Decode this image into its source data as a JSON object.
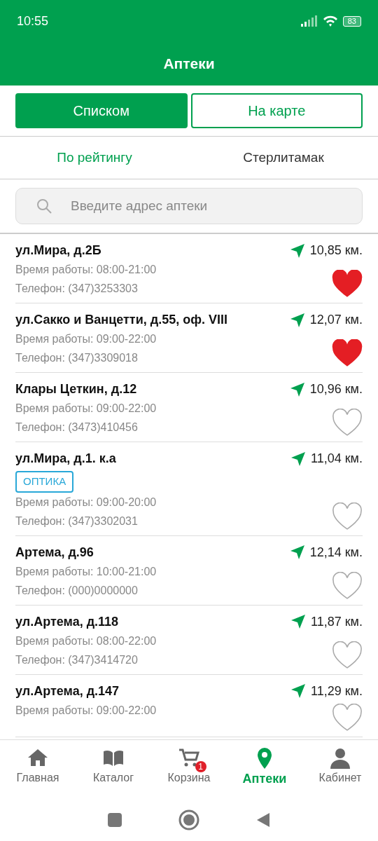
{
  "status_bar": {
    "time": "10:55",
    "battery": "83"
  },
  "header": {
    "title": "Аптеки"
  },
  "view_toggle": [
    {
      "label": "Списком",
      "selected": true
    },
    {
      "label": "На карте",
      "selected": false
    }
  ],
  "filters": [
    {
      "label": "По рейтингу",
      "selected": true
    },
    {
      "label": "Стерлитамак",
      "selected": false
    }
  ],
  "search": {
    "placeholder": "Введите адрес аптеки"
  },
  "pharmacies": [
    {
      "address": "ул.Мира, д.2Б",
      "distance": "10,85 км.",
      "hours": "Время работы: 08:00-21:00",
      "phone": "Телефон: (347)3253303",
      "favorite": true
    },
    {
      "address": "ул.Сакко и Ванцетти, д.55, оф. VIII",
      "distance": "12,07 км.",
      "hours": "Время работы: 09:00-22:00",
      "phone": "Телефон: (347)3309018",
      "favorite": true
    },
    {
      "address": "Клары Цеткин, д.12",
      "distance": "10,96 км.",
      "hours": "Время работы: 09:00-22:00",
      "phone": "Телефон: (3473)410456",
      "favorite": false
    },
    {
      "address": "ул.Мира, д.1. к.а",
      "distance": "11,04 км.",
      "tag": "ОПТИКА",
      "hours": "Время работы: 09:00-20:00",
      "phone": "Телефон: (347)3302031",
      "favorite": false
    },
    {
      "address": "Артема, д.96",
      "distance": "12,14 км.",
      "hours": "Время работы: 10:00-21:00",
      "phone": "Телефон: (000)0000000",
      "favorite": false
    },
    {
      "address": "ул.Артема, д.118",
      "distance": "11,87 км.",
      "hours": "Время работы: 08:00-22:00",
      "phone": "Телефон: (347)3414720",
      "favorite": false
    },
    {
      "address": "ул.Артема, д.147",
      "distance": "11,29 км.",
      "hours": "Время работы: 09:00-22:00",
      "favorite": false
    }
  ],
  "bottom_nav": [
    {
      "label": "Главная",
      "selected": false
    },
    {
      "label": "Каталог",
      "selected": false
    },
    {
      "label": "Корзина",
      "selected": false,
      "badge": "1"
    },
    {
      "label": "Аптеки",
      "selected": true
    },
    {
      "label": "Кабинет",
      "selected": false
    }
  ]
}
